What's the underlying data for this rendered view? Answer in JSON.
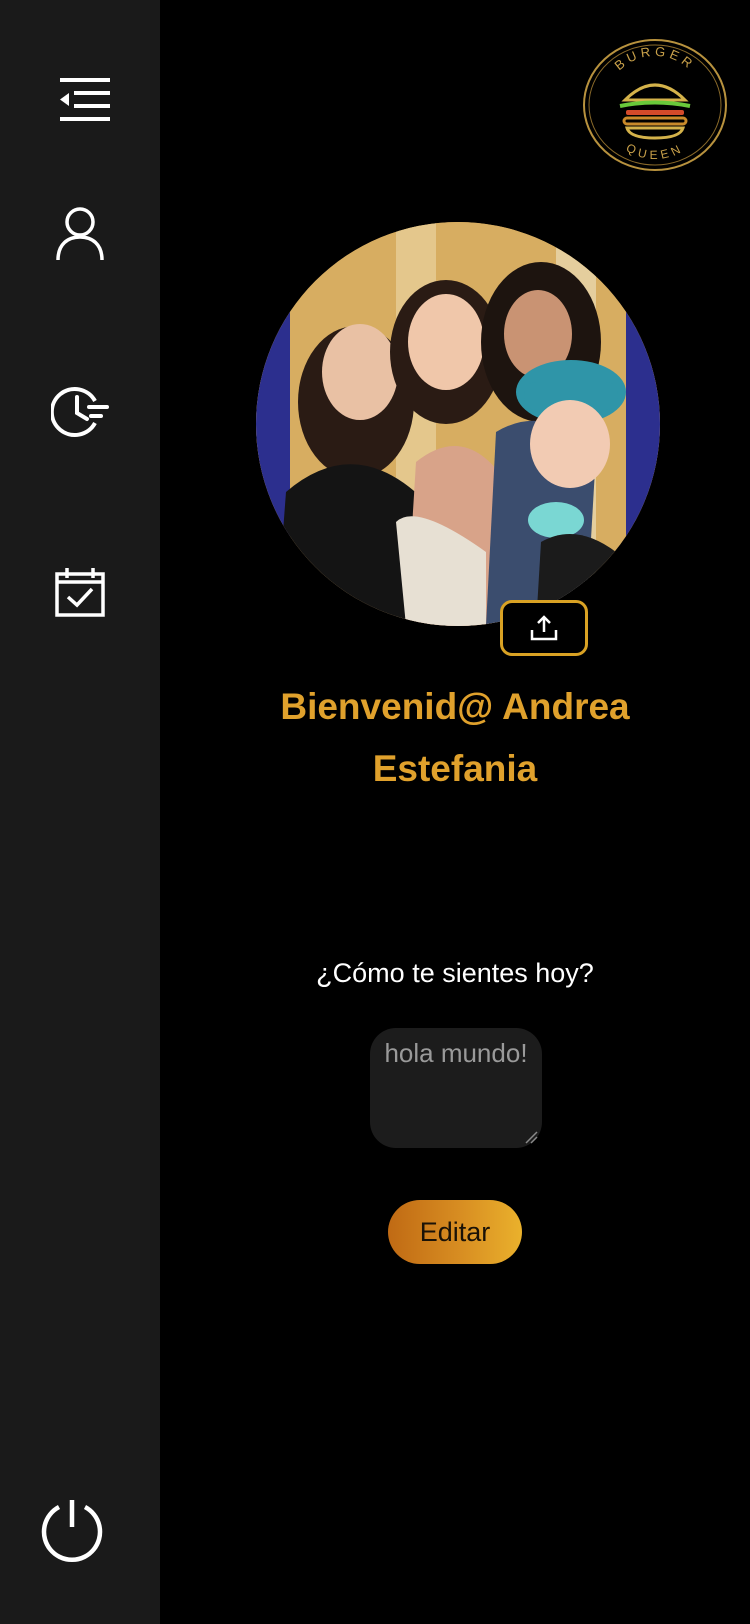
{
  "sidebar": {
    "items": [
      {
        "icon": "collapse-menu-icon"
      },
      {
        "icon": "user-icon"
      },
      {
        "icon": "history-clock-icon"
      },
      {
        "icon": "calendar-check-icon"
      },
      {
        "icon": "power-icon"
      }
    ],
    "background": "#1a1a1a"
  },
  "logo": {
    "top_text": "BURGER",
    "bottom_text": "QUEEN",
    "icon": "burger-icon"
  },
  "profile": {
    "avatar_icon": "profile-photo",
    "upload_icon": "upload-icon",
    "welcome": "Bienvenid@ Andrea Estefania"
  },
  "mood": {
    "question": "¿Cómo te sientes hoy?",
    "value": "hola mundo!"
  },
  "actions": {
    "edit_label": "Editar"
  },
  "colors": {
    "accent": "#e0a12c",
    "button_gradient_start": "#c06a14",
    "button_gradient_end": "#eab12c",
    "background": "#000000"
  }
}
